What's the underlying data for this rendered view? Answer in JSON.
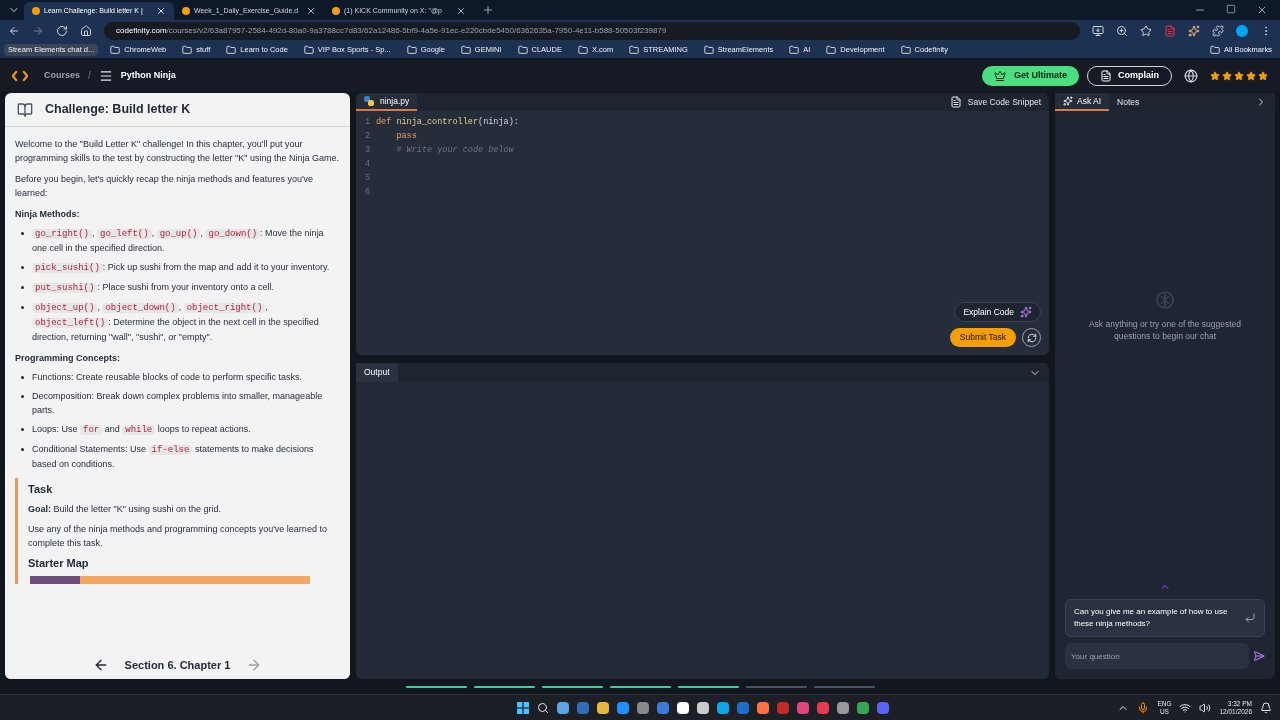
{
  "browser": {
    "tabs": [
      {
        "title": "Learn Challenge: Build letter K |",
        "selected": true
      },
      {
        "title": "Week_1_Daily_Exercise_Guide.d",
        "selected": false
      },
      {
        "title": "(1) KICK Community on X: \"@p",
        "selected": false
      }
    ],
    "url_host": "codefinity.com",
    "url_path": "/courses/v2/63a87957-2584-492d-80a0-9a3788cc7d83/62a12486-5bf9-4a5e-91ec-e220cbde5450/6362635a-7950-4e11-b588-50503f239879",
    "bookmarks": [
      "Stream Elements chat d...",
      "ChromeWeb",
      "stuff",
      "Learn to Code",
      "VIP Box Sports - Sp...",
      "Google",
      "GEMINI",
      "CLAUDE",
      "X.com",
      "STREAMING",
      "StreamElements",
      "AI",
      "Development",
      "Codefinity"
    ],
    "all_bookmarks": "All Bookmarks"
  },
  "header": {
    "breadcrumb": [
      "Courses",
      "Python Ninja"
    ],
    "separator": "/",
    "get_ultimate": "Get Ultimate",
    "complain": "Complain",
    "stars": 5
  },
  "challenge": {
    "title": "Challenge: Build letter K",
    "intro": [
      "Welcome to the \"Build Letter K\" challenge! In this chapter, you'll put your programming skills to the test by constructing the letter \"K\" using the Ninja Game.",
      "Before you begin, let's quickly recap the ninja methods and features you've learned:"
    ],
    "sections": [
      {
        "heading": "Ninja Methods:",
        "items": [
          [
            {
              "kind": "code",
              "text": "go_right()"
            },
            {
              "kind": "text",
              "text": ", "
            },
            {
              "kind": "code",
              "text": "go_left()"
            },
            {
              "kind": "text",
              "text": ", "
            },
            {
              "kind": "code",
              "text": "go_up()"
            },
            {
              "kind": "text",
              "text": ", "
            },
            {
              "kind": "code",
              "text": "go_down()"
            },
            {
              "kind": "text",
              "text": ": Move the ninja one cell in the specified direction."
            }
          ],
          [
            {
              "kind": "code",
              "text": "pick_sushi()"
            },
            {
              "kind": "text",
              "text": ": Pick up sushi from the map and add it to your inventory."
            }
          ],
          [
            {
              "kind": "code",
              "text": "put_sushi()"
            },
            {
              "kind": "text",
              "text": ": Place sushi from your inventory onto a cell."
            }
          ],
          [
            {
              "kind": "code",
              "text": "object_up()"
            },
            {
              "kind": "text",
              "text": ", "
            },
            {
              "kind": "code",
              "text": "object_down()"
            },
            {
              "kind": "text",
              "text": ", "
            },
            {
              "kind": "code",
              "text": "object_right()"
            },
            {
              "kind": "text",
              "text": ", "
            },
            {
              "kind": "code",
              "text": "object_left()"
            },
            {
              "kind": "text",
              "text": ": Determine the object in the next cell in the specified direction, returning \"wall\", \"sushi\", or \"empty\"."
            }
          ]
        ]
      },
      {
        "heading": "Programming Concepts:",
        "items": [
          [
            {
              "kind": "text",
              "text": "Functions: Create reusable blocks of code to perform specific tasks."
            }
          ],
          [
            {
              "kind": "text",
              "text": "Decomposition: Break down complex problems into smaller, manageable parts."
            }
          ],
          [
            {
              "kind": "text",
              "text": "Loops: Use "
            },
            {
              "kind": "code",
              "text": "for"
            },
            {
              "kind": "text",
              "text": " and "
            },
            {
              "kind": "code",
              "text": "while"
            },
            {
              "kind": "text",
              "text": " loops to repeat actions."
            }
          ],
          [
            {
              "kind": "text",
              "text": "Conditional Statements: Use "
            },
            {
              "kind": "code",
              "text": "if-else"
            },
            {
              "kind": "text",
              "text": " statements to make decisions based on conditions."
            }
          ]
        ]
      }
    ],
    "task": {
      "title": "Task",
      "goal": "**Goal:** Build the letter \"K\" using sushi on the grid.",
      "text": "Use any of the ninja methods and programming concepts you've learned to complete this task.",
      "map_title": "Starter Map"
    },
    "footer": "Section 6. Chapter 1"
  },
  "editor": {
    "file": "ninja.py",
    "save": "Save Code Snippet",
    "lines": [
      {
        "number": "1",
        "tokens": [
          {
            "kind": "keyword",
            "text": "def"
          },
          {
            "kind": "function",
            "text": " ninja_controller"
          },
          {
            "kind": "plain",
            "text": "(ninja):"
          }
        ]
      },
      {
        "number": "2",
        "tokens": [
          {
            "kind": "keyword",
            "text": "    pass"
          }
        ]
      },
      {
        "number": "3",
        "tokens": [
          {
            "kind": "comment",
            "text": "    # Write your code below"
          }
        ]
      },
      {
        "number": "4"
      },
      {
        "number": "5"
      },
      {
        "number": "6"
      }
    ],
    "explain": "Explain Code",
    "submit": "Submit Task",
    "output": "Output"
  },
  "assistant": {
    "tabs": [
      {
        "label": "Ask AI",
        "selected": true
      },
      {
        "label": "Notes",
        "selected": false
      }
    ],
    "empty_text": "Ask anything or try one of the suggested questions to begin our chat",
    "suggestion": "Can you give me an example of how to use these ninja methods?",
    "placeholder": "Your question"
  },
  "progress": [
    {
      "completed": true
    },
    {
      "completed": true
    },
    {
      "completed": true
    },
    {
      "completed": true
    },
    {
      "completed": true
    },
    {
      "completed": false
    },
    {
      "completed": false
    }
  ],
  "taskbar": {
    "language": "ENG",
    "region": "US",
    "time": "3:32 PM",
    "date": "12/01/2026"
  }
}
